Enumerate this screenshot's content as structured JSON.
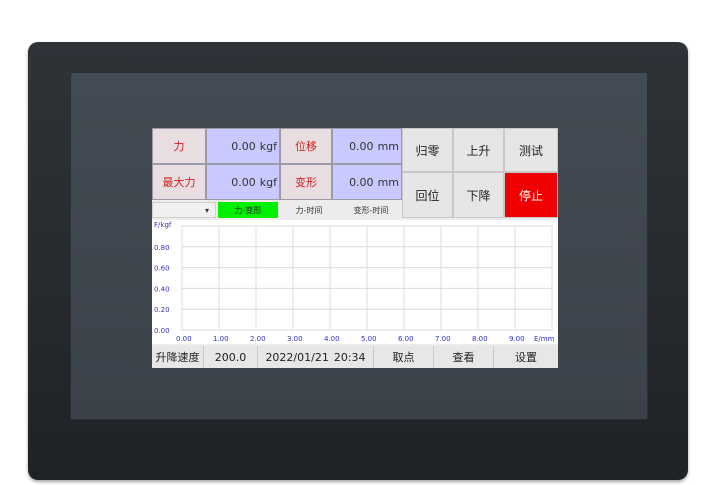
{
  "readouts": {
    "force_label": "力",
    "force_value": "0.00",
    "force_unit": "kgf",
    "max_force_label": "最大力",
    "max_force_value": "0.00",
    "max_force_unit": "kgf",
    "displacement_label": "位移",
    "displacement_value": "0.00",
    "displacement_unit": "mm",
    "deformation_label": "变形",
    "deformation_value": "0.00",
    "deformation_unit": "mm"
  },
  "buttons": {
    "zero": "归零",
    "up": "上升",
    "test": "测试",
    "return": "回位",
    "down": "下降",
    "stop": "停止"
  },
  "tabs": {
    "dropdown_arrow": "▾",
    "force_deformation": "力-变形",
    "force_time": "力-时间",
    "deformation_time": "变形-时间"
  },
  "chart_data": {
    "type": "line",
    "ylabel": "F/kgf",
    "xlabel": "E/mm",
    "xlim": [
      0,
      10
    ],
    "ylim": [
      0,
      1
    ],
    "y_ticks": [
      "0.80",
      "0.60",
      "0.40",
      "0.20",
      "0.00"
    ],
    "x_ticks": [
      "0.00",
      "1.00",
      "2.00",
      "3.00",
      "4.00",
      "5.00",
      "6.00",
      "7.00",
      "8.00",
      "9.00"
    ],
    "series": [],
    "grid": true
  },
  "bottom_bar": {
    "speed_label": "升降速度",
    "speed_value": "200.0",
    "date": "2022/01/21",
    "time": "20:34",
    "pick_point": "取点",
    "view": "查看",
    "settings": "设置"
  }
}
